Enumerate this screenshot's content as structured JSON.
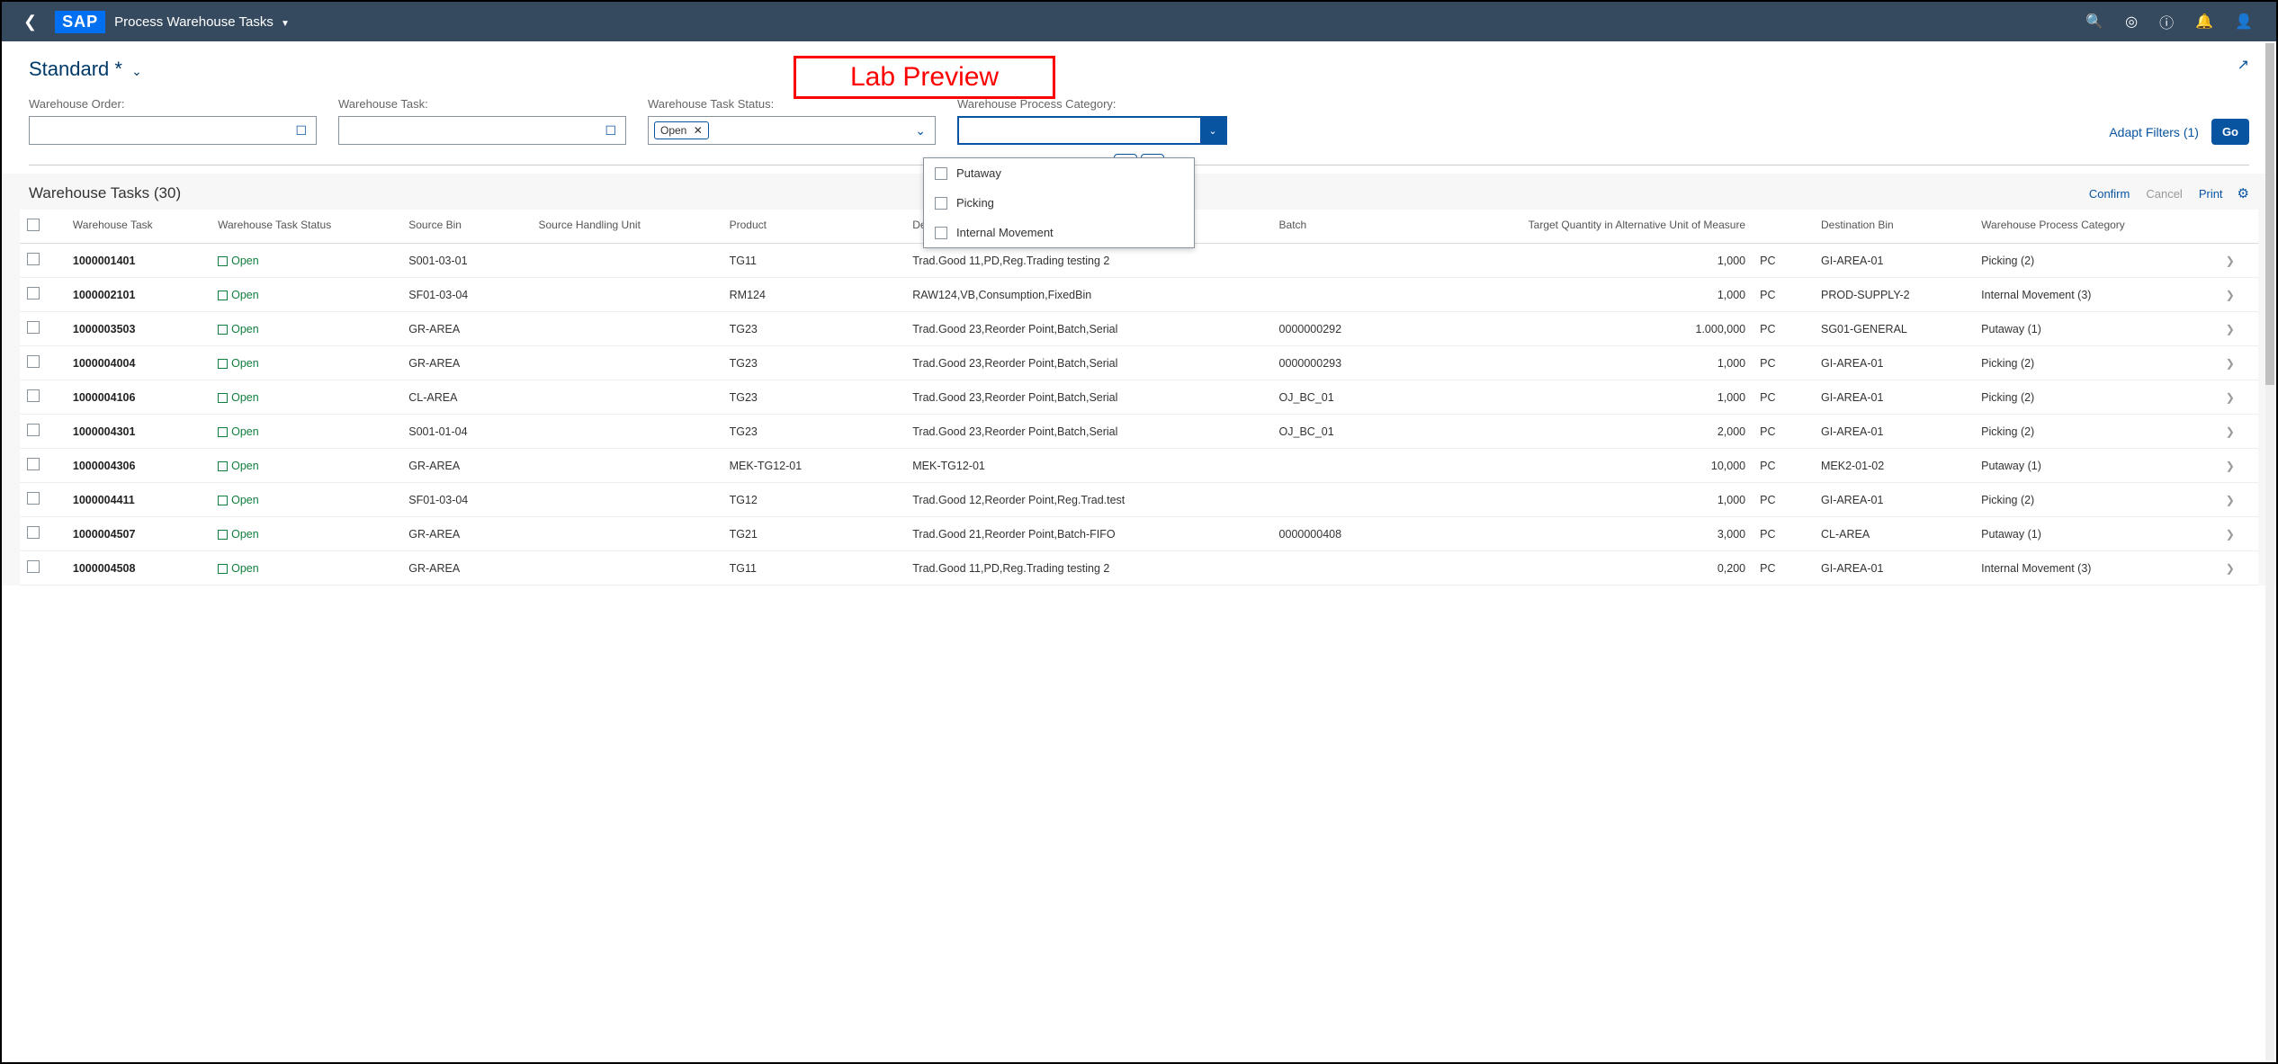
{
  "shell": {
    "title": "Process Warehouse Tasks",
    "logo": "SAP"
  },
  "variant": {
    "name": "Standard *"
  },
  "annotation": "Lab Preview",
  "filters": {
    "order": {
      "label": "Warehouse Order:"
    },
    "task": {
      "label": "Warehouse Task:"
    },
    "status": {
      "label": "Warehouse Task Status:",
      "token": "Open"
    },
    "category": {
      "label": "Warehouse Process Category:"
    },
    "adapt": "Adapt Filters (1)",
    "go": "Go",
    "options": [
      "Putaway",
      "Picking",
      "Internal Movement"
    ]
  },
  "table": {
    "title": "Warehouse Tasks (30)",
    "toolbar": {
      "confirm": "Confirm",
      "cancel": "Cancel",
      "print": "Print"
    },
    "columns": [
      "Warehouse Task",
      "Warehouse Task Status",
      "Source Bin",
      "Source Handling Unit",
      "Product",
      "Description",
      "Batch",
      "Target Quantity in Alternative Unit of Measure",
      "",
      "Destination Bin",
      "Warehouse Process Category"
    ],
    "rows": [
      {
        "task": "1000001401",
        "status": "Open",
        "sbin": "S001-03-01",
        "shu": "",
        "product": "TG11",
        "desc": "Trad.Good 11,PD,Reg.Trading testing 2",
        "batch": "",
        "qty": "1,000",
        "uom": "PC",
        "dbin": "GI-AREA-01",
        "cat": "Picking (2)"
      },
      {
        "task": "1000002101",
        "status": "Open",
        "sbin": "SF01-03-04",
        "shu": "",
        "product": "RM124",
        "desc": "RAW124,VB,Consumption,FixedBin",
        "batch": "",
        "qty": "1,000",
        "uom": "PC",
        "dbin": "PROD-SUPPLY-2",
        "cat": "Internal Movement (3)"
      },
      {
        "task": "1000003503",
        "status": "Open",
        "sbin": "GR-AREA",
        "shu": "",
        "product": "TG23",
        "desc": "Trad.Good 23,Reorder Point,Batch,Serial",
        "batch": "0000000292",
        "qty": "1.000,000",
        "uom": "PC",
        "dbin": "SG01-GENERAL",
        "cat": "Putaway (1)"
      },
      {
        "task": "1000004004",
        "status": "Open",
        "sbin": "GR-AREA",
        "shu": "",
        "product": "TG23",
        "desc": "Trad.Good 23,Reorder Point,Batch,Serial",
        "batch": "0000000293",
        "qty": "1,000",
        "uom": "PC",
        "dbin": "GI-AREA-01",
        "cat": "Picking (2)"
      },
      {
        "task": "1000004106",
        "status": "Open",
        "sbin": "CL-AREA",
        "shu": "",
        "product": "TG23",
        "desc": "Trad.Good 23,Reorder Point,Batch,Serial",
        "batch": "OJ_BC_01",
        "qty": "1,000",
        "uom": "PC",
        "dbin": "GI-AREA-01",
        "cat": "Picking (2)"
      },
      {
        "task": "1000004301",
        "status": "Open",
        "sbin": "S001-01-04",
        "shu": "",
        "product": "TG23",
        "desc": "Trad.Good 23,Reorder Point,Batch,Serial",
        "batch": "OJ_BC_01",
        "qty": "2,000",
        "uom": "PC",
        "dbin": "GI-AREA-01",
        "cat": "Picking (2)"
      },
      {
        "task": "1000004306",
        "status": "Open",
        "sbin": "GR-AREA",
        "shu": "",
        "product": "MEK-TG12-01",
        "desc": "MEK-TG12-01",
        "batch": "",
        "qty": "10,000",
        "uom": "PC",
        "dbin": "MEK2-01-02",
        "cat": "Putaway (1)"
      },
      {
        "task": "1000004411",
        "status": "Open",
        "sbin": "SF01-03-04",
        "shu": "",
        "product": "TG12",
        "desc": "Trad.Good 12,Reorder Point,Reg.Trad.test",
        "batch": "",
        "qty": "1,000",
        "uom": "PC",
        "dbin": "GI-AREA-01",
        "cat": "Picking (2)"
      },
      {
        "task": "1000004507",
        "status": "Open",
        "sbin": "GR-AREA",
        "shu": "",
        "product": "TG21",
        "desc": "Trad.Good 21,Reorder Point,Batch-FIFO",
        "batch": "0000000408",
        "qty": "3,000",
        "uom": "PC",
        "dbin": "CL-AREA",
        "cat": "Putaway (1)"
      },
      {
        "task": "1000004508",
        "status": "Open",
        "sbin": "GR-AREA",
        "shu": "",
        "product": "TG11",
        "desc": "Trad.Good 11,PD,Reg.Trading testing 2",
        "batch": "",
        "qty": "0,200",
        "uom": "PC",
        "dbin": "GI-AREA-01",
        "cat": "Internal Movement (3)"
      }
    ]
  }
}
